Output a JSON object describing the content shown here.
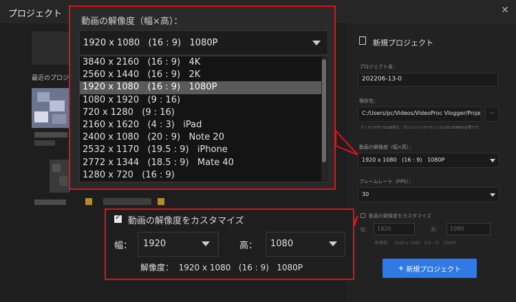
{
  "window": {
    "title": "プロジェクト",
    "close_label": "✕"
  },
  "left": {
    "recent_label": "最近のプロジ"
  },
  "resolution_dropdown": {
    "label": "動画の解像度（幅×高）：",
    "selected": "1920 x 1080   (16 : 9)   1080P",
    "options": [
      "3840 x 2160   (16 : 9)   4K",
      "2560 x 1440   (16 : 9)   2K",
      "1920 x 1080   (16 : 9)   1080P",
      "1080 x 1920   (9 : 16)",
      "720 x 1280   (9 : 16)",
      "2160 x 1620   (4 : 3)   iPad",
      "2400 x 1080   (20 : 9)   Note 20",
      "2532 x 1170   (19.5 : 9)   iPhone",
      "2772 x 1344   (18.5 : 9)   Mate 40",
      "1280 x 720   (16 : 9)"
    ],
    "selected_index": 2
  },
  "custom_resolution": {
    "checkbox_label": "動画の解像度をカスタマイズ",
    "width_label": "幅：",
    "width_value": "1920",
    "height_label": "高：",
    "height_value": "1080",
    "summary": "解像度：  1920 x 1080   (16 : 9)   1080P",
    "checked": true
  },
  "right_panel": {
    "header": "新規プロジェクト",
    "name_label": "プロジェクト名：",
    "name_value": "202206-13-0",
    "save_label": "保存先：",
    "save_path": "C:/Users/pc/Videos/VideoProc Vlogger/Project",
    "browse_label": "···",
    "disk_info": "ディスクが57.61GB残り，プロジェクトが少なくとも100.00MBが必要です。",
    "res_label": "動画の解像度（幅×高）：",
    "res_value": "1920 x 1080   (16 : 9)   1080P",
    "fps_label": "フレームレート（FPS）：",
    "fps_value": "30",
    "custom_label": "動画の解像度をカスタマイズ",
    "w_label": "幅：",
    "w_value": "1920",
    "h_label": "高：",
    "h_value": "1080",
    "summary": "解像度：  1920 x 1080   (16 : 9)   1080P",
    "create_button": "新規プロジェクト"
  },
  "colors": {
    "accent": "#2f7ae5",
    "callout": "#e0121a",
    "selected_row": "#5a5a5a"
  }
}
